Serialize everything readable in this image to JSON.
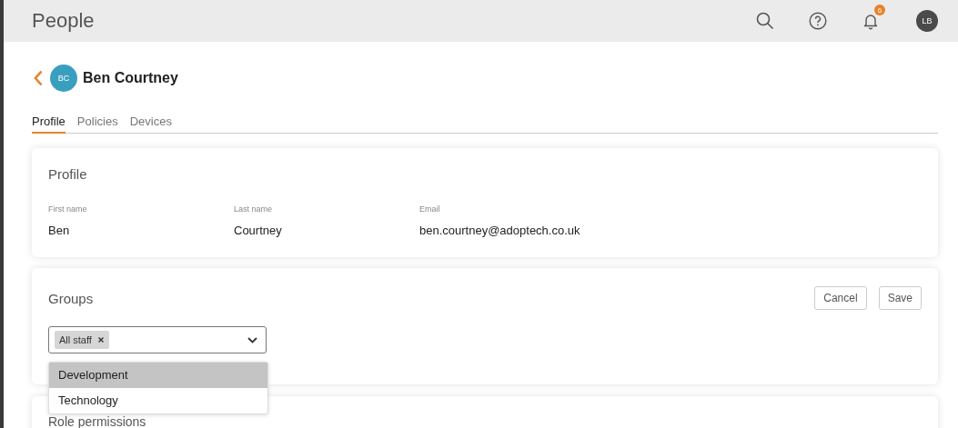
{
  "header": {
    "title": "People",
    "notification_count": "6",
    "user_initials": "LB"
  },
  "person": {
    "initials": "BC",
    "name": "Ben Courtney"
  },
  "tabs": [
    {
      "label": "Profile",
      "selected": true
    },
    {
      "label": "Policies",
      "selected": false
    },
    {
      "label": "Devices",
      "selected": false
    }
  ],
  "profile": {
    "title": "Profile",
    "fields": [
      {
        "label": "First name",
        "value": "Ben"
      },
      {
        "label": "Last name",
        "value": "Courtney"
      },
      {
        "label": "Email",
        "value": "ben.courtney@adoptech.co.uk"
      }
    ]
  },
  "groups": {
    "title": "Groups",
    "buttons": [
      "Cancel",
      "Save"
    ],
    "select": {
      "chips": [
        "All staff"
      ],
      "expanded": true,
      "options": [
        {
          "label": "Development",
          "highlighted": true
        },
        {
          "label": "Technology",
          "highlighted": false
        }
      ]
    }
  },
  "role_permissions": {
    "title": "Role permissions"
  }
}
